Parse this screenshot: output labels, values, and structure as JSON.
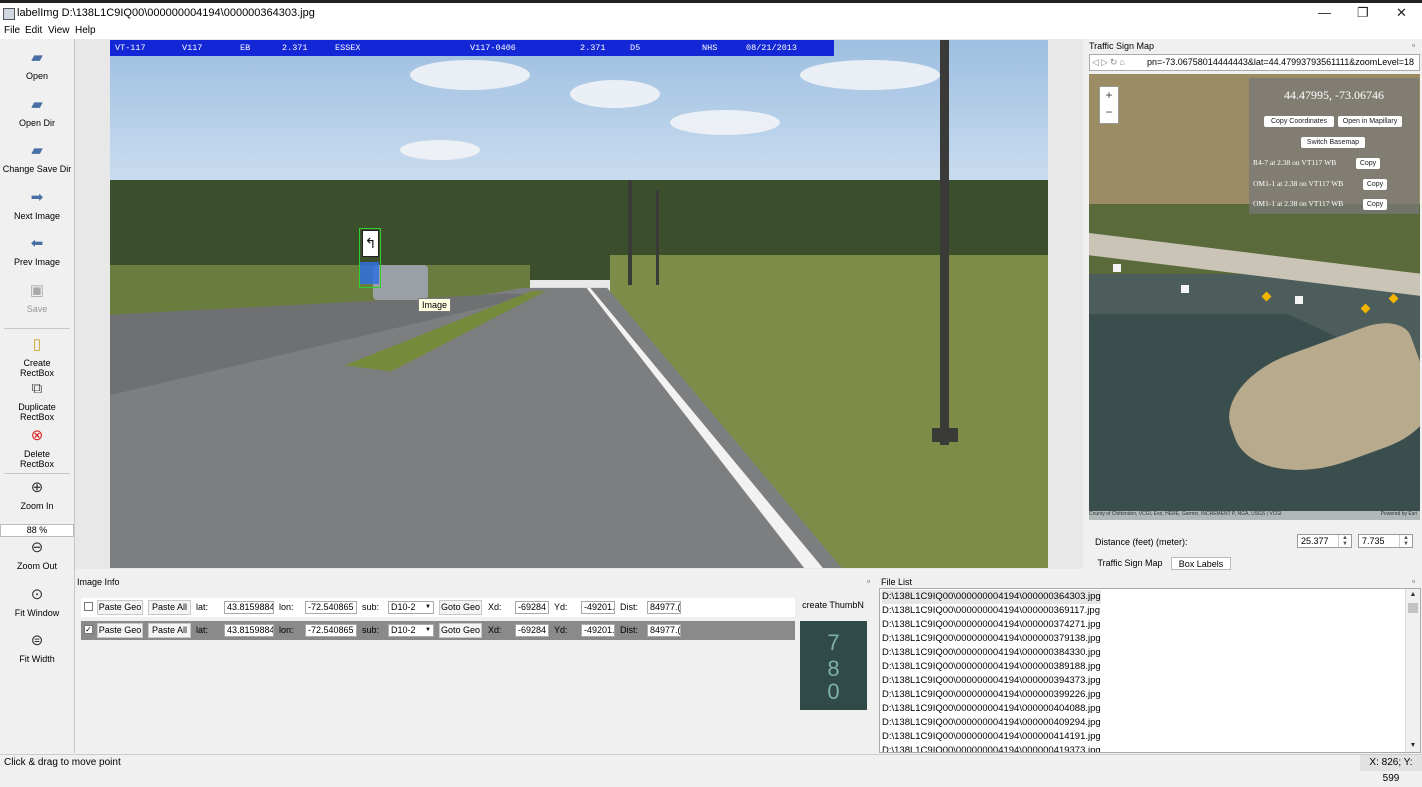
{
  "window": {
    "title": "labelImg D:\\138L1C9IQ00\\000000004194\\000000364303.jpg",
    "minimize": "—",
    "restore": "❐",
    "close": "✕"
  },
  "menu": [
    "File",
    "Edit",
    "View",
    "Help"
  ],
  "toolbar": {
    "open": "Open",
    "open_dir": "Open Dir",
    "change_save_dir": "Change Save Dir",
    "next_image": "Next Image",
    "prev_image": "Prev Image",
    "save": "Save",
    "create_rectbox": [
      "Create",
      "RectBox"
    ],
    "duplicate_rectbox": [
      "Duplicate",
      "RectBox"
    ],
    "delete_rectbox": [
      "Delete",
      "RectBox"
    ],
    "zoom_in": "Zoom In",
    "zoom_value": "88 %",
    "zoom_out": "Zoom Out",
    "fit_window": "Fit Window",
    "fit_width": "Fit Width"
  },
  "photo_banner": {
    "route": "VT-117",
    "code": "V117",
    "dir": "EB",
    "mile": "2.371",
    "county": "ESSEX",
    "segment": "V117-0406",
    "mile2": "2.371",
    "lane": "D5",
    "system": "NHS",
    "date": "08/21/2013"
  },
  "canvas": {
    "tooltip": "Image",
    "sign_glyph": "↰"
  },
  "traffic_sign_map": {
    "title": "Traffic Sign Map",
    "url": "pn=-73.06758014444443&lat=44.47993793561111&zoomLevel=18",
    "zoom_plus": "+",
    "zoom_minus": "−",
    "coords": "44.47995, -73.06746",
    "copy_coordinates": "Copy Coordinates",
    "open_in_mapillary": "Open in Mapillary",
    "switch_basemap": "Switch Basemap",
    "signs": [
      {
        "text": "R4-7 at 2.38 on VT117 WB",
        "copy": "Copy"
      },
      {
        "text": "OM1-1 at 2.38 on VT117 WB",
        "copy": "Copy"
      },
      {
        "text": "OM1-1 at 2.38 on VT117 WB",
        "copy": "Copy"
      }
    ],
    "attribution": "County of Chittenden, VCGI, Esri, HERE, Garmin, INCREMENT P, NGA, USGS | VCGI",
    "powered": "Powered by Esri",
    "distance_label": "Distance (feet) (meter):",
    "distance_feet": "25.377",
    "distance_meter": "7.735",
    "tabs": [
      "Traffic Sign Map",
      "Box Labels"
    ]
  },
  "image_info": {
    "title": "Image Info",
    "rows": [
      {
        "checked": false,
        "paste_geo": "Paste Geo",
        "paste_all": "Paste All",
        "lat_label": "lat:",
        "lat": "43.8159884",
        "lon_label": "lon:",
        "lon": "-72.540865",
        "sub_label": "sub:",
        "sub": "D10-2",
        "goto_geo": "Goto Geo",
        "xd_label": "Xd:",
        "xd": "-69284",
        "yd_label": "Yd:",
        "yd": "-49201.",
        "dist_label": "Dist:",
        "dist": "84977.("
      },
      {
        "checked": true,
        "paste_geo": "Paste Geo",
        "paste_all": "Paste All",
        "lat_label": "lat:",
        "lat": "43.8159884",
        "lon_label": "lon:",
        "lon": "-72.540865",
        "sub_label": "sub:",
        "sub": "D10-2",
        "goto_geo": "Goto Geo",
        "xd_label": "Xd:",
        "xd": "-69284",
        "yd_label": "Yd:",
        "yd": "-49201.",
        "dist_label": "Dist:",
        "dist": "84977.("
      }
    ],
    "create_thumb": "create ThumbN",
    "thumb_text": [
      "7",
      "8",
      "0"
    ]
  },
  "file_list": {
    "title": "File List",
    "items": [
      "D:\\138L1C9IQ00\\000000004194\\000000364303.jpg",
      "D:\\138L1C9IQ00\\000000004194\\000000369117.jpg",
      "D:\\138L1C9IQ00\\000000004194\\000000374271.jpg",
      "D:\\138L1C9IQ00\\000000004194\\000000379138.jpg",
      "D:\\138L1C9IQ00\\000000004194\\000000384330.jpg",
      "D:\\138L1C9IQ00\\000000004194\\000000389188.jpg",
      "D:\\138L1C9IQ00\\000000004194\\000000394373.jpg",
      "D:\\138L1C9IQ00\\000000004194\\000000399226.jpg",
      "D:\\138L1C9IQ00\\000000004194\\000000404088.jpg",
      "D:\\138L1C9IQ00\\000000004194\\000000409294.jpg",
      "D:\\138L1C9IQ00\\000000004194\\000000414191.jpg",
      "D:\\138L1C9IQ00\\000000004194\\000000419373.jpg"
    ]
  },
  "status": {
    "message": "Click & drag to move point",
    "coordinates": "X: 826; Y: 599"
  },
  "colors": {
    "banner": "#1327d6",
    "bbox": "#2fd12f",
    "selection": "#2f6fe0"
  }
}
